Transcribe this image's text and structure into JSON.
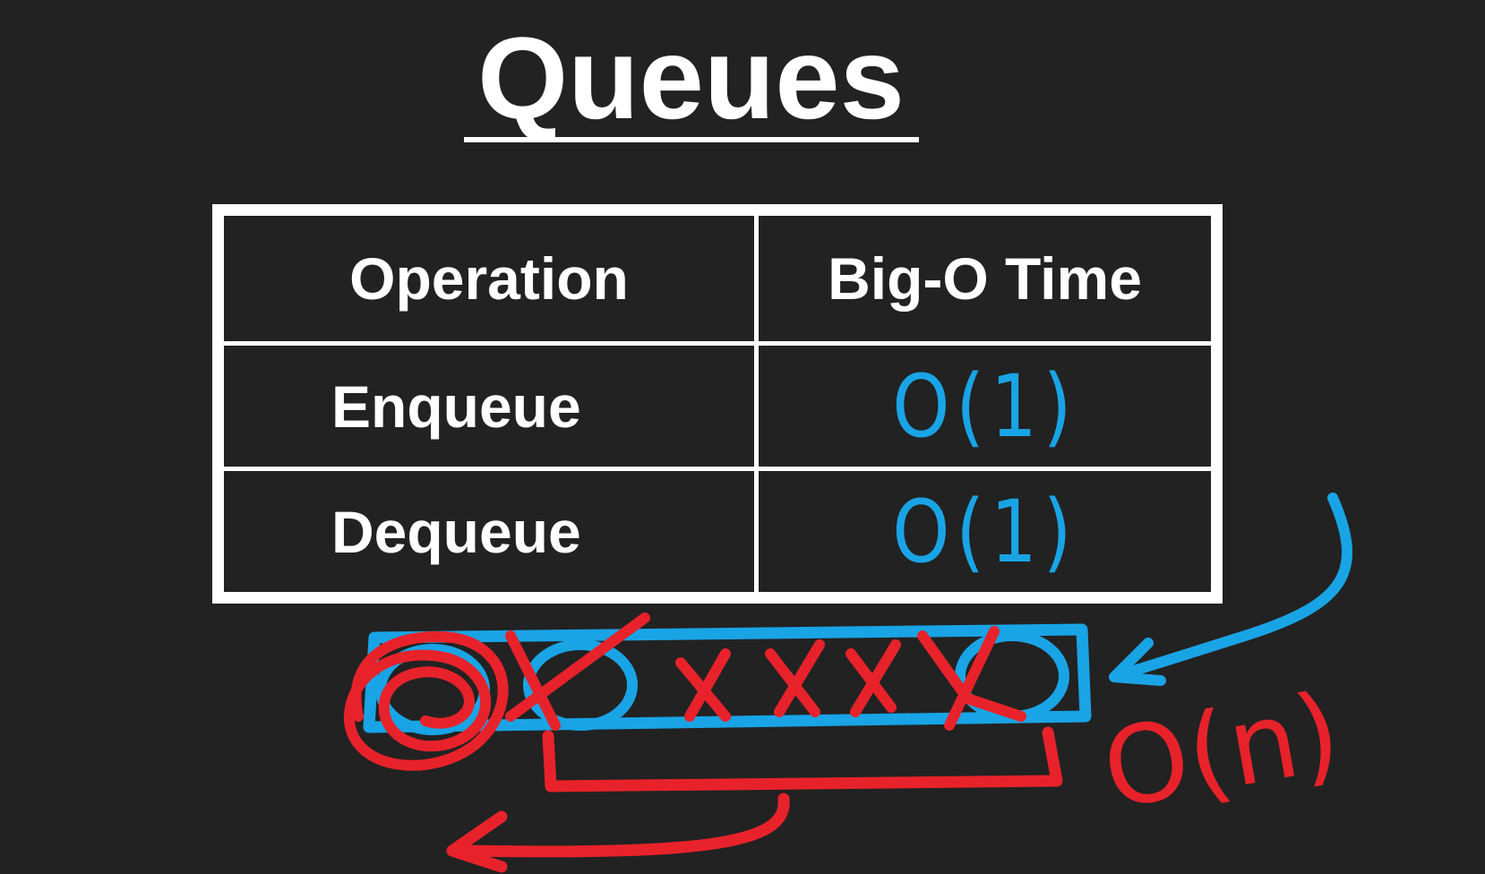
{
  "title": "Queues",
  "table": {
    "headers": [
      "Operation",
      "Big-O Time"
    ],
    "rows": [
      {
        "operation": "Enqueue",
        "time": "O(1)"
      },
      {
        "operation": "Dequeue",
        "time": "O(1)"
      }
    ]
  },
  "annotation": "O(n)",
  "colors": {
    "background": "#222222",
    "text": "#ffffff",
    "blue_ink": "#19a4e6",
    "red_ink": "#e8222a"
  }
}
